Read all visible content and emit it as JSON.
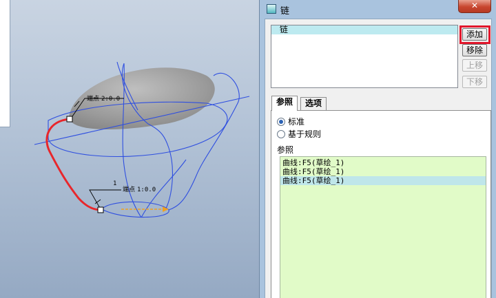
{
  "viewport": {
    "dim_top": "2:0.0",
    "dim_bottom": "1:0.0",
    "dim_bottom_small": "1",
    "dim_prefix": "端点"
  },
  "dialog": {
    "title": "链",
    "close_glyph": "✕",
    "chain_list": {
      "items": [
        "链"
      ],
      "selected_index": 0
    },
    "buttons": {
      "add": "添加",
      "remove": "移除",
      "move_up": "上移",
      "move_down": "下移"
    },
    "tabs": {
      "references": "参照",
      "options": "选项",
      "active": "参照"
    },
    "type_options": {
      "standard": "标准",
      "rule_based": "基于规则",
      "selected": "标准"
    },
    "references_label": "参照",
    "references": [
      "曲线:F5(草绘_1)",
      "曲线:F5(草绘_1)",
      "曲线:F5(草绘_1)"
    ],
    "selected_reference_index": 2
  },
  "colors": {
    "chain_curve": "#e8262b",
    "wire": "#2f4fe0",
    "highlight": "#e2172c"
  }
}
